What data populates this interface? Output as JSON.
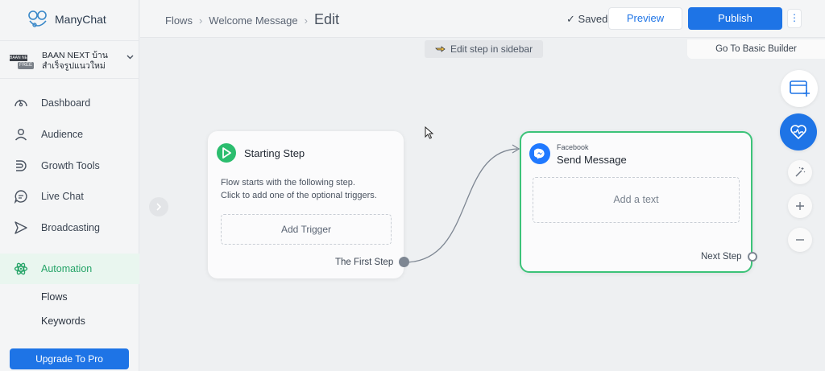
{
  "brand": {
    "name": "ManyChat"
  },
  "account": {
    "logo_text": "BAAN NE",
    "plan_badge": "FREE",
    "name": "BAAN NEXT บ้านสำเร็จรูปแนวใหม่"
  },
  "nav": {
    "items": [
      {
        "label": "Dashboard",
        "icon": "gauge-icon"
      },
      {
        "label": "Audience",
        "icon": "person-icon"
      },
      {
        "label": "Growth Tools",
        "icon": "growth-icon"
      },
      {
        "label": "Live Chat",
        "icon": "chat-icon"
      },
      {
        "label": "Broadcasting",
        "icon": "send-icon"
      },
      {
        "label": "Automation",
        "icon": "atom-icon",
        "active": true
      }
    ],
    "sub_items": [
      {
        "label": "Flows"
      },
      {
        "label": "Keywords"
      }
    ],
    "upgrade_label": "Upgrade To Pro"
  },
  "breadcrumb": {
    "items": [
      "Flows",
      "Welcome Message"
    ],
    "current": "Edit"
  },
  "toolbar": {
    "saved_label": "Saved",
    "preview_label": "Preview",
    "publish_label": "Publish",
    "more_label": "⋮",
    "basic_builder_label": "Go To Basic Builder"
  },
  "hint": {
    "label": "Edit step in sidebar"
  },
  "canvas": {
    "start_step": {
      "title": "Starting Step",
      "description_line1": "Flow starts with the following step.",
      "description_line2": "Click to add one of the optional triggers.",
      "add_trigger_label": "Add Trigger",
      "output_label": "The First Step"
    },
    "send_message": {
      "channel": "Facebook",
      "title": "Send Message",
      "add_text_label": "Add a text",
      "output_label": "Next Step"
    }
  },
  "colors": {
    "accent": "#1e74e6",
    "success": "#3cc379",
    "messenger": "#2079ff"
  }
}
